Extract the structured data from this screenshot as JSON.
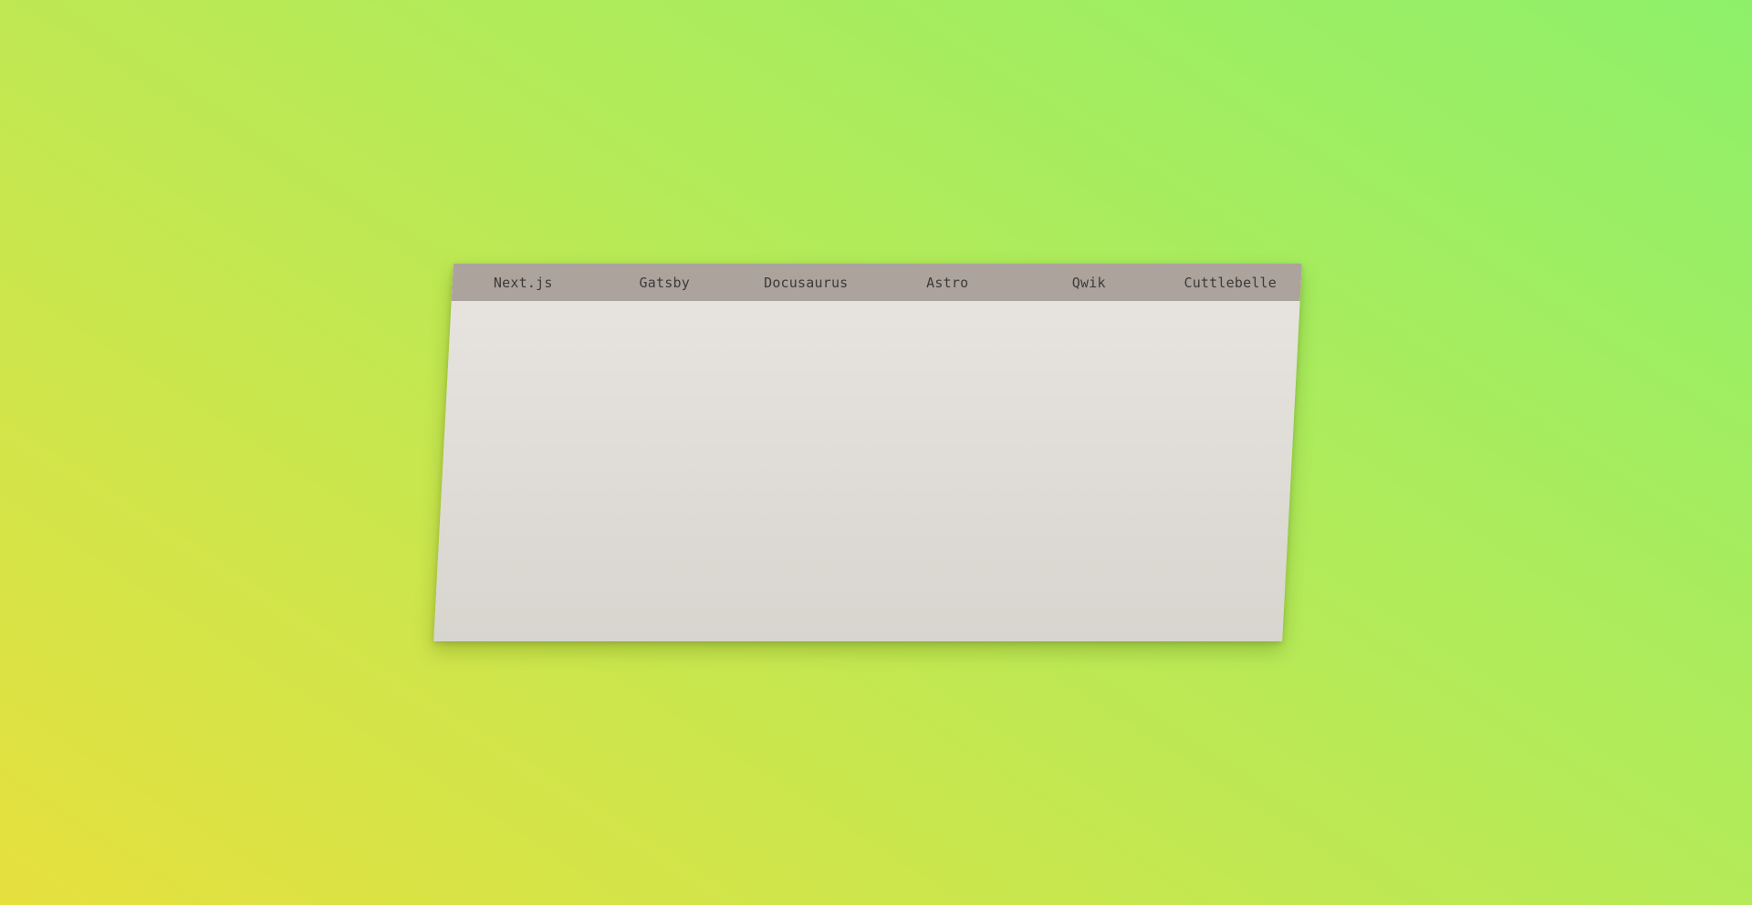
{
  "tabs": [
    {
      "label": "Next.js"
    },
    {
      "label": "Gatsby"
    },
    {
      "label": "Docusaurus"
    },
    {
      "label": "Astro"
    },
    {
      "label": "Qwik"
    },
    {
      "label": "Cuttlebelle"
    }
  ],
  "colors": {
    "background_start": "#e6e03e",
    "background_end": "#8ef06a",
    "tabbar": "#aca39d",
    "panel": "#e3e0db",
    "tab_text": "#3c3a39"
  }
}
